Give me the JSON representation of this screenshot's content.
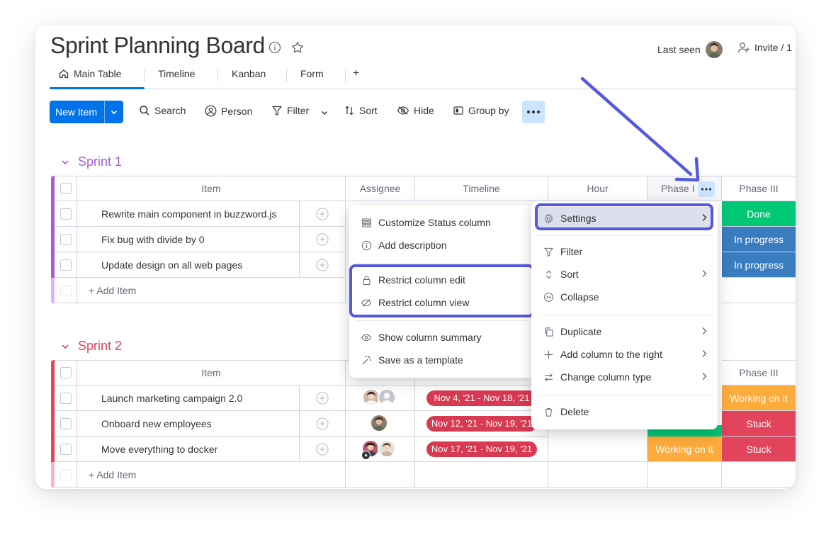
{
  "board": {
    "title": "Sprint Planning Board",
    "last_seen_label": "Last seen",
    "invite_label": "Invite / 1"
  },
  "tabs": [
    {
      "label": "Main Table",
      "active": true
    },
    {
      "label": "Timeline"
    },
    {
      "label": "Kanban"
    },
    {
      "label": "Form"
    },
    {
      "label": "+"
    }
  ],
  "toolbar": {
    "new_item": "New Item",
    "search": "Search",
    "person": "Person",
    "filter": "Filter",
    "sort": "Sort",
    "hide": "Hide",
    "group_by": "Group by"
  },
  "columns": {
    "item": "Item",
    "assignee": "Assignee",
    "timeline": "Timeline",
    "hour": "Hour",
    "phase1": "Phase I",
    "phase3": "Phase III"
  },
  "groups": [
    {
      "title": "Sprint 1",
      "color": "#a25ddc",
      "add_item": "+ Add Item",
      "rows": [
        {
          "item": "Rewrite main component in buzzword.js",
          "phase3": "Done",
          "phase3_color": "#00c875"
        },
        {
          "item": "Fix bug with divide by 0",
          "phase3": "In progress",
          "phase3_color": "#3a7cc0"
        },
        {
          "item": "Update design on all web pages",
          "phase3": "In progress",
          "phase3_color": "#3a7cc0"
        }
      ]
    },
    {
      "title": "Sprint 2",
      "color": "#e2445c",
      "add_item": "+ Add Item",
      "rows": [
        {
          "item": "Launch marketing campaign 2.0",
          "timeline": "Nov 4, '21 - Nov 18, '21",
          "phase3": "Working on it",
          "phase3_color": "#fdab3d"
        },
        {
          "item": "Onboard new employees",
          "timeline": "Nov 12, '21 - Nov 19, '21",
          "phase3": "Stuck",
          "phase3_color": "#e2445c"
        },
        {
          "item": "Move everything to docker",
          "timeline": "Nov 17, '21 - Nov 19, '21",
          "phase1": "Working on it",
          "phase1_color": "#fdab3d",
          "phase3": "Stuck",
          "phase3_color": "#e2445c"
        }
      ]
    }
  ],
  "column_menu": {
    "settings": "Settings",
    "filter": "Filter",
    "sort": "Sort",
    "collapse": "Collapse",
    "duplicate": "Duplicate",
    "add_column_right": "Add column to the right",
    "change_column_type": "Change column type",
    "delete": "Delete"
  },
  "settings_submenu": {
    "customize_status": "Customize Status column",
    "add_description": "Add description",
    "restrict_edit": "Restrict column edit",
    "restrict_view": "Restrict column view",
    "show_summary": "Show column summary",
    "save_template": "Save as a template"
  },
  "colors": {
    "primary": "#0073ea",
    "highlight": "#5559df",
    "green": "#00c875",
    "blue": "#3a7cc0",
    "orange": "#fdab3d",
    "red": "#e2445c"
  }
}
